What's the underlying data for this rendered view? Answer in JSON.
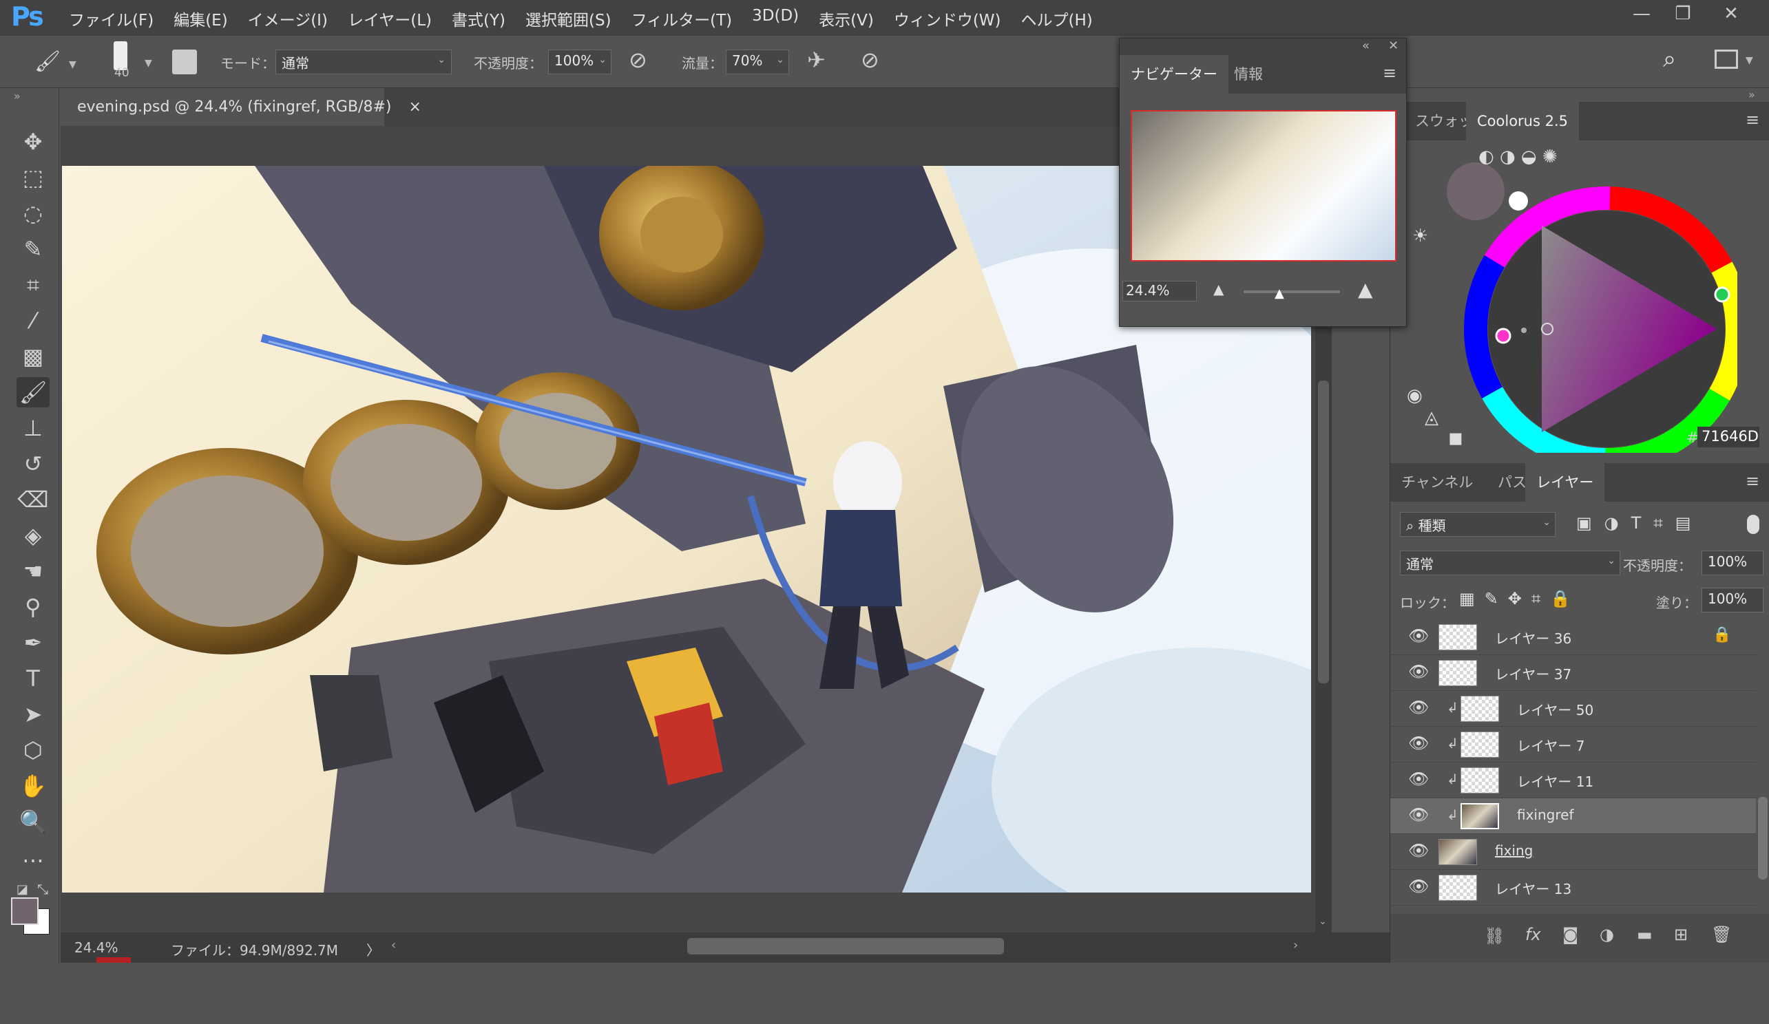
{
  "app": {
    "logo": "Ps"
  },
  "menu": [
    "ファイル(F)",
    "編集(E)",
    "イメージ(I)",
    "レイヤー(L)",
    "書式(Y)",
    "選択範囲(S)",
    "フィルター(T)",
    "3D(D)",
    "表示(V)",
    "ウィンドウ(W)",
    "ヘルプ(H)"
  ],
  "window_controls": {
    "minimize": "—",
    "restore": "❐",
    "close": "✕"
  },
  "options": {
    "brush_size": "40",
    "mode_label": "モード：",
    "mode_value": "通常",
    "opacity_label": "不透明度：",
    "opacity_value": "100%",
    "flow_label": "流量：",
    "flow_value": "70%"
  },
  "document": {
    "tab_title": "evening.psd @ 24.4% (fixingref, RGB/8#)",
    "close": "×"
  },
  "status": {
    "zoom": "24.4%",
    "file_info": "ファイル：94.9M/892.7M",
    "arrow": "〉"
  },
  "navigator": {
    "tabs": [
      "ナビゲーター",
      "情報"
    ],
    "zoom": "24.4%",
    "collapse": "«",
    "close": "✕"
  },
  "color_panel": {
    "tabs": [
      "スウォッチ",
      "Coolorus 2.5"
    ],
    "hex_label": "#",
    "hex_value": "71646D",
    "current_color": "#71646D"
  },
  "layers_panel": {
    "tabs": [
      "チャンネル",
      "パス",
      "レイヤー"
    ],
    "filter_kind": "種類",
    "blend_mode": "通常",
    "opacity_label": "不透明度：",
    "opacity_value": "100%",
    "lock_label": "ロック：",
    "fill_label": "塗り：",
    "fill_value": "100%",
    "layers": [
      {
        "name": "レイヤー 36",
        "clipped": false,
        "locked": true,
        "selected": false
      },
      {
        "name": "レイヤー 37",
        "clipped": false,
        "locked": false,
        "selected": false
      },
      {
        "name": "レイヤー 50",
        "clipped": true,
        "locked": false,
        "selected": false
      },
      {
        "name": "レイヤー 7",
        "clipped": true,
        "locked": false,
        "selected": false
      },
      {
        "name": "レイヤー 11",
        "clipped": true,
        "locked": false,
        "selected": false
      },
      {
        "name": "fixingref",
        "clipped": true,
        "locked": false,
        "selected": true
      },
      {
        "name": "fixing",
        "clipped": false,
        "locked": false,
        "selected": false
      },
      {
        "name": "レイヤー 13",
        "clipped": false,
        "locked": false,
        "selected": false
      }
    ],
    "footer_fx": "fx"
  },
  "colors": {
    "accent": "#4aa7ff",
    "panel": "#535353",
    "dark": "#424242"
  }
}
